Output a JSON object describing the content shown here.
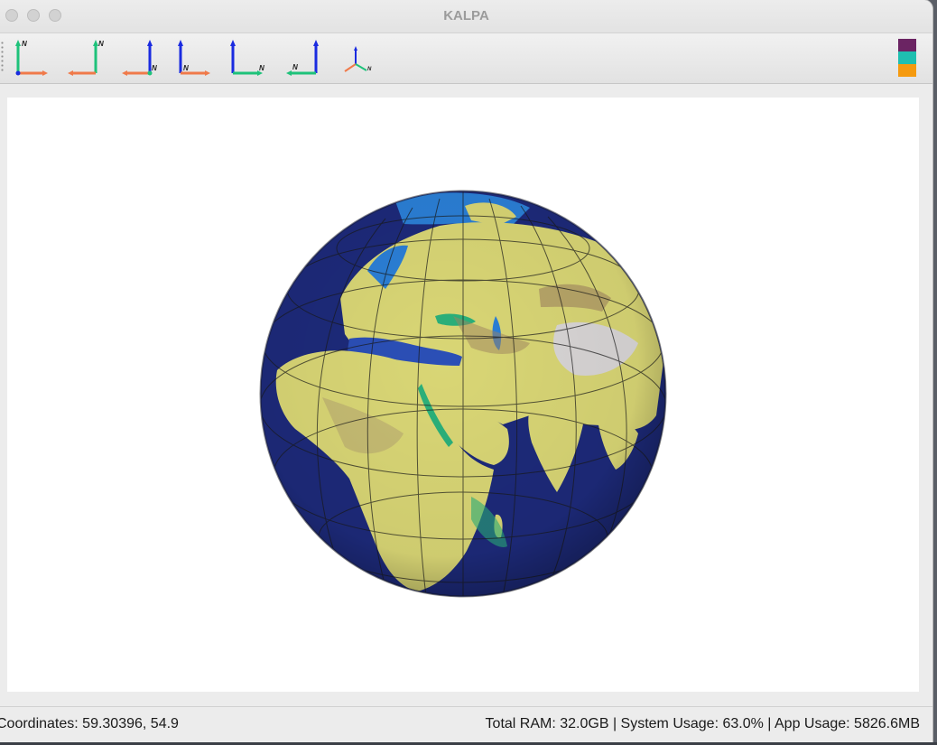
{
  "window": {
    "title": "KALPA"
  },
  "toolbar": {
    "view_buttons": [
      {
        "icon": "view-axes-icon",
        "label": "N"
      },
      {
        "icon": "view-axes-icon",
        "label": "N"
      },
      {
        "icon": "view-axes-icon",
        "label": "N"
      },
      {
        "icon": "view-axes-icon",
        "label": "N"
      },
      {
        "icon": "view-axes-icon",
        "label": "N"
      },
      {
        "icon": "view-axes-icon",
        "label": "N"
      },
      {
        "icon": "view-3d-axes-icon",
        "label": "N"
      }
    ],
    "color_swatches": [
      "#6b2463",
      "#1fbfb0",
      "#f59a0f"
    ]
  },
  "colors": {
    "axis_x": "#f07a4a",
    "axis_y": "#1ec27a",
    "axis_z": "#1a2be0",
    "ocean": "#1d2a7a",
    "land_low": "#d9d675",
    "land_high": "#8a6d55",
    "ice": "#d9d6d6"
  },
  "status": {
    "coordinates": "Coordinates: 59.30396, 54.9",
    "system_info": "Total RAM: 32.0GB | System Usage: 63.0% | App Usage: 5826.6MB"
  }
}
